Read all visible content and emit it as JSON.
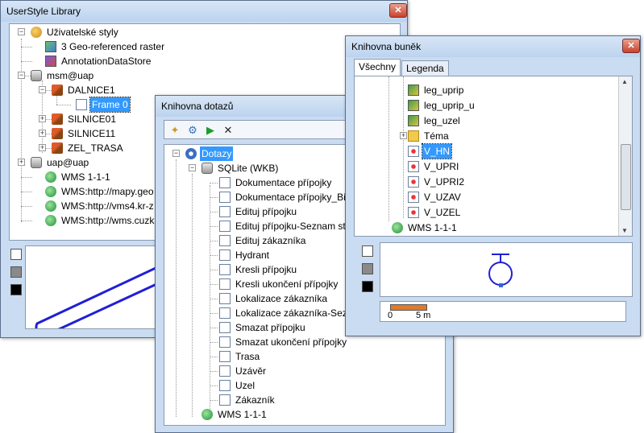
{
  "win1": {
    "title": "UserStyle Library",
    "close": "✕",
    "tree": [
      {
        "label": "Uživatelské styly",
        "icon": "styles-icon"
      },
      {
        "label": "3 Geo-referenced raster",
        "icon": "raster-icon"
      },
      {
        "label": "AnnotationDataStore",
        "icon": "annotation-icon"
      },
      {
        "label": "msm@uap",
        "icon": "odbc-icon"
      },
      {
        "label": "DALNICE1",
        "icon": "brush-icon"
      },
      {
        "label": "Frame 0",
        "icon": "page-icon"
      },
      {
        "label": "SILNICE01",
        "icon": "brush-icon"
      },
      {
        "label": "SILNICE11",
        "icon": "brush-icon"
      },
      {
        "label": "ZEL_TRASA",
        "icon": "brush-icon"
      },
      {
        "label": "uap@uap",
        "icon": "odbc-icon"
      },
      {
        "label": "WMS 1-1-1",
        "icon": "wms-icon"
      },
      {
        "label": "WMS:http://mapy.geo",
        "icon": "wms-icon"
      },
      {
        "label": "WMS:http://vms4.kr-z",
        "icon": "wms-icon"
      },
      {
        "label": "WMS:http://wms.cuzk",
        "icon": "wms-icon"
      }
    ]
  },
  "win2": {
    "title": "Knihovna dotazů",
    "root": "Dotazy",
    "db": "SQLite (WKB)",
    "items": [
      "Dokumentace přípojky",
      "Dokumentace přípojky_Bin",
      "Edituj přípojku",
      "Edituj přípojku-Seznam stat",
      "Edituj zákazníka",
      "Hydrant",
      "Kresli přípojku",
      "Kresli ukončení přípojky",
      "Lokalizace zákazníka",
      "Lokalizace zákazníka-Sezna",
      "Smazat přípojku",
      "Smazat ukončení přípojky",
      "Trasa",
      "Uzávěr",
      "Uzel",
      "Zákazník"
    ],
    "wms": "WMS 1-1-1"
  },
  "win3": {
    "title": "Knihovna buněk",
    "close": "✕",
    "tabs": [
      "Všechny",
      "Legenda"
    ],
    "items": [
      {
        "label": "leg_uprip",
        "icon": "cell-icon"
      },
      {
        "label": "leg_uprip_u",
        "icon": "cell-icon"
      },
      {
        "label": "leg_uzel",
        "icon": "cell-icon"
      },
      {
        "label": "Téma",
        "icon": "folder-icon"
      },
      {
        "label": "V_HN",
        "icon": "cell-red-icon"
      },
      {
        "label": "V_UPRI",
        "icon": "cell-red-icon"
      },
      {
        "label": "V_UPRI2",
        "icon": "cell-red-icon"
      },
      {
        "label": "V_UZAV",
        "icon": "cell-red-icon"
      },
      {
        "label": "V_UZEL",
        "icon": "cell-red-icon"
      },
      {
        "label": "WMS 1-1-1",
        "icon": "wms-icon"
      }
    ],
    "scale_start": "0",
    "scale_end": "5 m"
  },
  "colors": {
    "accent": "#3399ff",
    "preview_line": "#1f1fd6"
  }
}
